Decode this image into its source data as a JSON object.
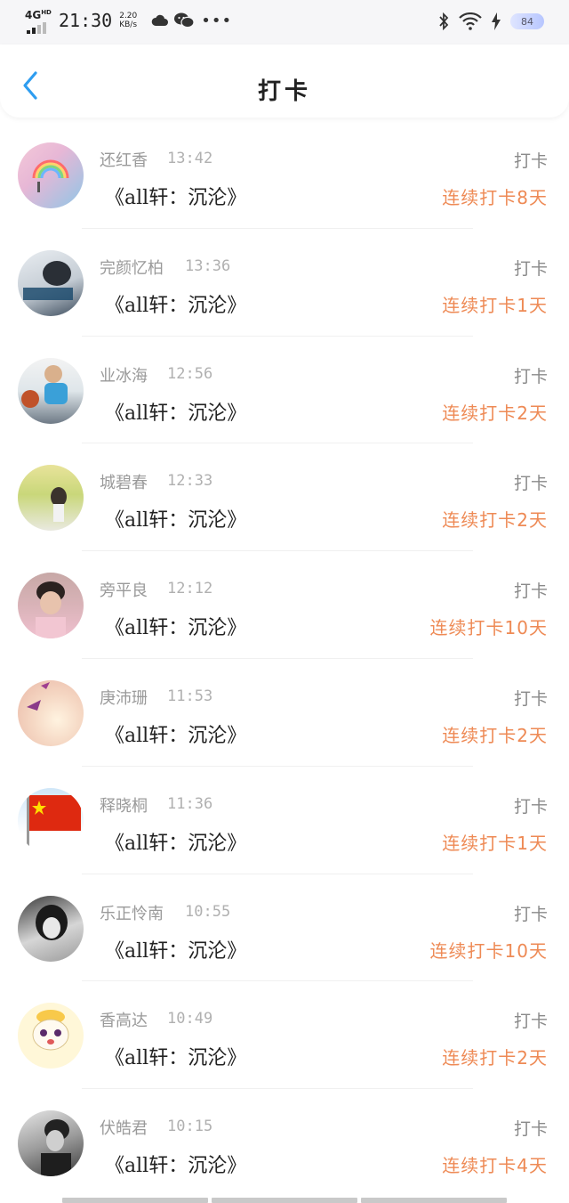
{
  "status_bar": {
    "network": "4G",
    "network_sup": "HD",
    "time": "21:30",
    "speed_value": "2.20",
    "speed_unit": "KB/s",
    "battery": "84",
    "icons": [
      "cloud-icon",
      "wechat-icon",
      "more-icon",
      "bluetooth-icon",
      "wifi-icon",
      "charging-icon"
    ]
  },
  "header": {
    "title": "打卡",
    "back_icon": "chevron-left-icon",
    "accent_color": "#2e9df0"
  },
  "colors": {
    "streak": "#ee8a55",
    "name": "#9a9a9a",
    "divider": "#f0f0f0"
  },
  "items": [
    {
      "name": "还红香",
      "time": "13:42",
      "book": "《all轩：沉沦》",
      "action": "打卡",
      "streak": "连续打卡8天",
      "avatar": "rainbow-avatar"
    },
    {
      "name": "完颜忆柏",
      "time": "13:36",
      "book": "《all轩：沉沦》",
      "action": "打卡",
      "streak": "连续打卡1天",
      "avatar": "girl-avatar"
    },
    {
      "name": "业冰海",
      "time": "12:56",
      "book": "《all轩：沉沦》",
      "action": "打卡",
      "streak": "连续打卡2天",
      "avatar": "basketball-avatar"
    },
    {
      "name": "城碧春",
      "time": "12:33",
      "book": "《all轩：沉沦》",
      "action": "打卡",
      "streak": "连续打卡2天",
      "avatar": "field-avatar"
    },
    {
      "name": "旁平良",
      "time": "12:12",
      "book": "《all轩：沉沦》",
      "action": "打卡",
      "streak": "连续打卡10天",
      "avatar": "boy-avatar"
    },
    {
      "name": "庚沛珊",
      "time": "11:53",
      "book": "《all轩：沉沦》",
      "action": "打卡",
      "streak": "连续打卡2天",
      "avatar": "crane-avatar"
    },
    {
      "name": "释晓桐",
      "time": "11:36",
      "book": "《all轩：沉沦》",
      "action": "打卡",
      "streak": "连续打卡1天",
      "avatar": "flag-avatar"
    },
    {
      "name": "乐正怜南",
      "time": "10:55",
      "book": "《all轩：沉沦》",
      "action": "打卡",
      "streak": "连续打卡10天",
      "avatar": "bw-girl-avatar"
    },
    {
      "name": "香高达",
      "time": "10:49",
      "book": "《all轩：沉沦》",
      "action": "打卡",
      "streak": "连续打卡2天",
      "avatar": "cartoon-avatar"
    },
    {
      "name": "伏皓君",
      "time": "10:15",
      "book": "《all轩：沉沦》",
      "action": "打卡",
      "streak": "连续打卡4天",
      "avatar": "bw-boy-avatar"
    }
  ]
}
